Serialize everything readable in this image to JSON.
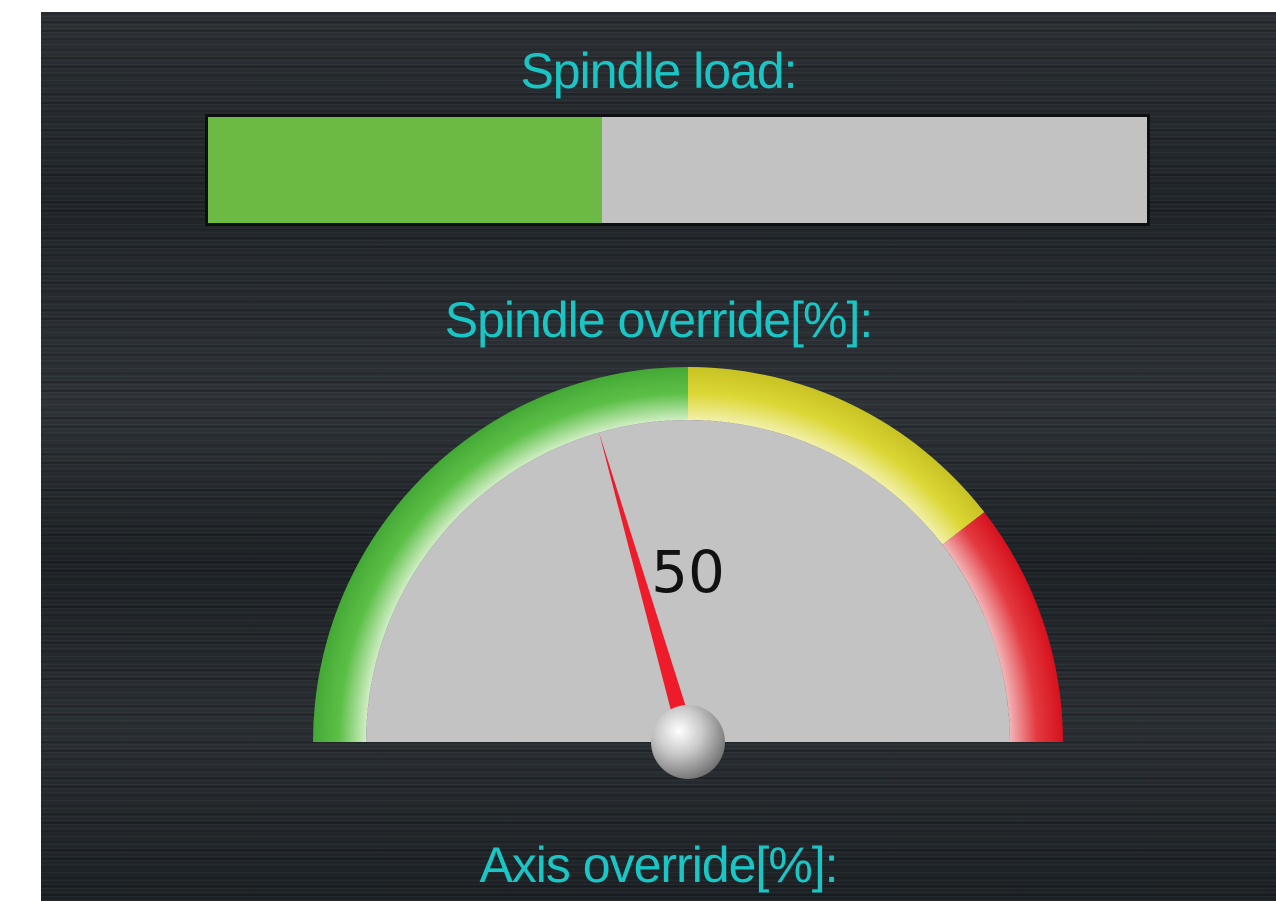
{
  "spindle_load": {
    "label": "Spindle load:",
    "level_fraction": 0.42,
    "fill_color": "#6cb944",
    "track_color": "#c2c2c2"
  },
  "spindle_override": {
    "label": "Spindle override[%]:",
    "value": "50",
    "gauge_min": 0,
    "gauge_max": 100,
    "zones": [
      {
        "from": 0,
        "to": 50,
        "color": "#4db33d"
      },
      {
        "from": 50,
        "to": 79,
        "color": "#d6d22a"
      },
      {
        "from": 79,
        "to": 100,
        "color": "#e0202a"
      }
    ],
    "needle_color": "#ee1c2b",
    "dial_color": "#c3c3c3"
  },
  "axis_override": {
    "label": "Axis override[%]:"
  }
}
